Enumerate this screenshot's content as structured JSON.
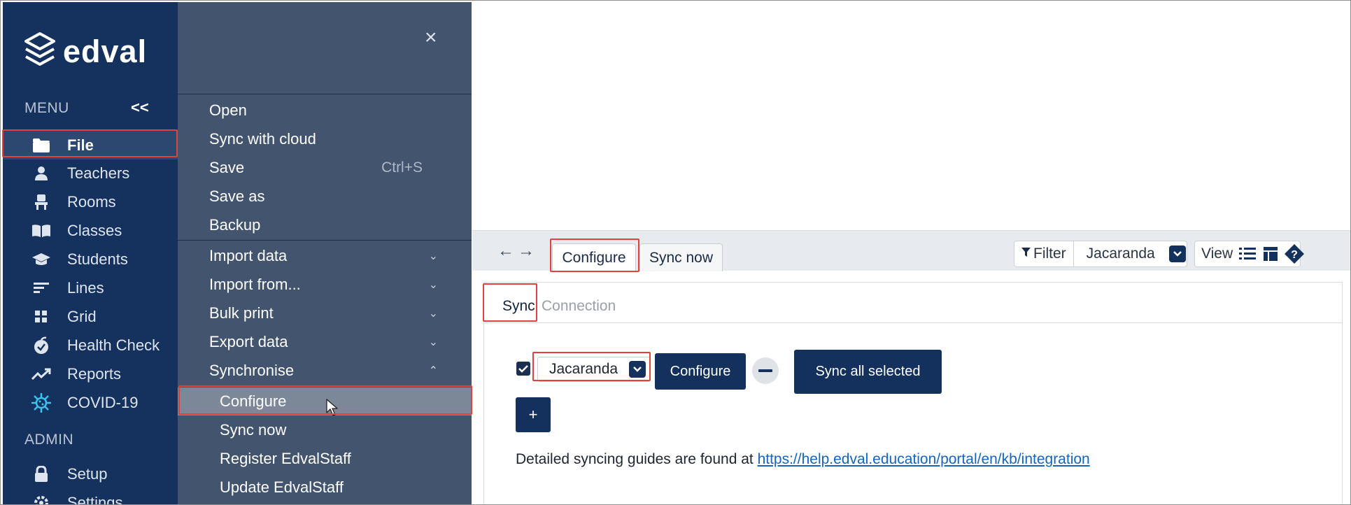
{
  "brand": {
    "name": "edval"
  },
  "nav": {
    "menu_label": "MENU",
    "collapse_label": "<<",
    "items": [
      {
        "label": "File",
        "icon": "folder-icon"
      },
      {
        "label": "Teachers",
        "icon": "person-icon"
      },
      {
        "label": "Rooms",
        "icon": "chair-icon"
      },
      {
        "label": "Classes",
        "icon": "book-icon"
      },
      {
        "label": "Students",
        "icon": "graduation-cap-icon"
      },
      {
        "label": "Lines",
        "icon": "lines-icon"
      },
      {
        "label": "Grid",
        "icon": "grid-icon"
      },
      {
        "label": "Health Check",
        "icon": "apple-icon"
      },
      {
        "label": "Reports",
        "icon": "trend-icon"
      },
      {
        "label": "COVID-19",
        "icon": "virus-icon"
      }
    ],
    "admin_label": "ADMIN",
    "admin_items": [
      {
        "label": "Setup",
        "icon": "lock-icon"
      },
      {
        "label": "Settings",
        "icon": "gear-icon"
      }
    ]
  },
  "submenu": {
    "close_label": "×",
    "items": [
      {
        "label": "Open"
      },
      {
        "label": "Sync with cloud"
      },
      {
        "label": "Save",
        "shortcut": "Ctrl+S"
      },
      {
        "label": "Save as"
      },
      {
        "label": "Backup"
      },
      {
        "label": "Import data",
        "chevron": "⌄"
      },
      {
        "label": "Import from...",
        "chevron": "⌄"
      },
      {
        "label": "Bulk print",
        "chevron": "⌄"
      },
      {
        "label": "Export data",
        "chevron": "⌄"
      },
      {
        "label": "Synchronise",
        "chevron": "⌃"
      },
      {
        "label": "Configure"
      },
      {
        "label": "Sync now"
      },
      {
        "label": "Register EdvalStaff"
      },
      {
        "label": "Update EdvalStaff"
      }
    ]
  },
  "toolbar": {
    "back_label": "←",
    "forward_label": "→",
    "tabs": [
      {
        "label": "Configure"
      },
      {
        "label": "Sync now"
      }
    ],
    "filter_label": "Filter",
    "filter_value": "Jacaranda",
    "view_label": "View"
  },
  "panel": {
    "subtabs": [
      {
        "label": "Sync"
      },
      {
        "label": "Connection"
      }
    ],
    "row": {
      "checked": true,
      "provider": "Jacaranda",
      "configure_label": "Configure",
      "remove_label": "−",
      "sync_all_label": "Sync all selected"
    },
    "add_label": "+",
    "guide_text": "Detailed syncing guides are found at ",
    "guide_link": "https://help.edval.education/portal/en/kb/integration"
  },
  "colors": {
    "nav_bg": "#15325e",
    "submenu_bg": "#43546e",
    "highlight_bg": "#7c8798",
    "primary_button": "#14305c",
    "annotation_red": "#e0423d",
    "link": "#1565c0"
  }
}
